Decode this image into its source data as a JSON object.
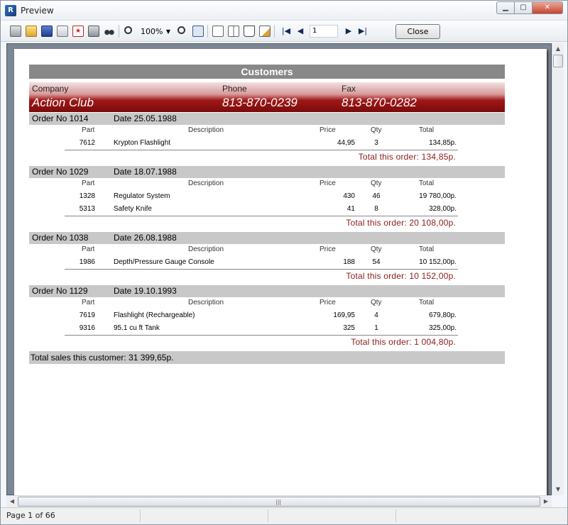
{
  "window": {
    "title": "Preview",
    "app_icon": "report-app-icon",
    "close_glyph": "✕",
    "max_glyph": "▢",
    "min_glyph": "▁"
  },
  "toolbar": {
    "zoom_value": "100%",
    "page_value": "1",
    "close_label": "Close",
    "icons": [
      "print-icon",
      "open-icon",
      "save-icon",
      "export-icon",
      "pdf-icon",
      "find-icon",
      "binoculars-icon",
      "zoom-in-icon",
      "zoom-out-icon",
      "page-width-icon",
      "single-page-icon",
      "two-pages-icon",
      "book-icon",
      "edit-icon",
      "first-page-icon",
      "prev-page-icon",
      "next-page-icon",
      "last-page-icon"
    ]
  },
  "report": {
    "title": "Customers",
    "customer": {
      "company_label": "Company",
      "company": "Action Club",
      "phone_label": "Phone",
      "phone": "813-870-0239",
      "fax_label": "Fax",
      "fax": "813-870-0282"
    },
    "columns": {
      "part": "Part",
      "description": "Description",
      "price": "Price",
      "qty": "Qty",
      "total": "Total"
    },
    "orders": [
      {
        "order_no": "Order No 1014",
        "date": "Date 25.05.1988",
        "items": [
          {
            "part": "7612",
            "description": "Krypton Flashlight",
            "price": "44,95",
            "qty": "3",
            "total": "134,85р."
          }
        ],
        "total": "Total this order: 134,85р."
      },
      {
        "order_no": "Order No 1029",
        "date": "Date 18.07.1988",
        "items": [
          {
            "part": "1328",
            "description": "Regulator System",
            "price": "430",
            "qty": "46",
            "total": "19 780,00р."
          },
          {
            "part": "5313",
            "description": "Safety Knife",
            "price": "41",
            "qty": "8",
            "total": "328,00р."
          }
        ],
        "total": "Total this order: 20 108,00р."
      },
      {
        "order_no": "Order No 1038",
        "date": "Date 26.08.1988",
        "items": [
          {
            "part": "1986",
            "description": "Depth/Pressure Gauge Console",
            "price": "188",
            "qty": "54",
            "total": "10 152,00р."
          }
        ],
        "total": "Total this order: 10 152,00р."
      },
      {
        "order_no": "Order No 1129",
        "date": "Date 19.10.1993",
        "items": [
          {
            "part": "7619",
            "description": "Flashlight (Rechargeable)",
            "price": "169,95",
            "qty": "4",
            "total": "679,80р."
          },
          {
            "part": "9316",
            "description": "95.1 cu ft Tank",
            "price": "325",
            "qty": "1",
            "total": "325,00р."
          }
        ],
        "total": "Total this order: 1 004,80р."
      }
    ],
    "customer_total": "Total sales this customer: 31 399,65р."
  },
  "status": {
    "page_info": "Page 1 of 66"
  },
  "colors": {
    "title_band": "#888888",
    "order_band": "#c8c8c8",
    "accent_red": "#8b1a1a",
    "preview_bg": "#7c8796"
  }
}
